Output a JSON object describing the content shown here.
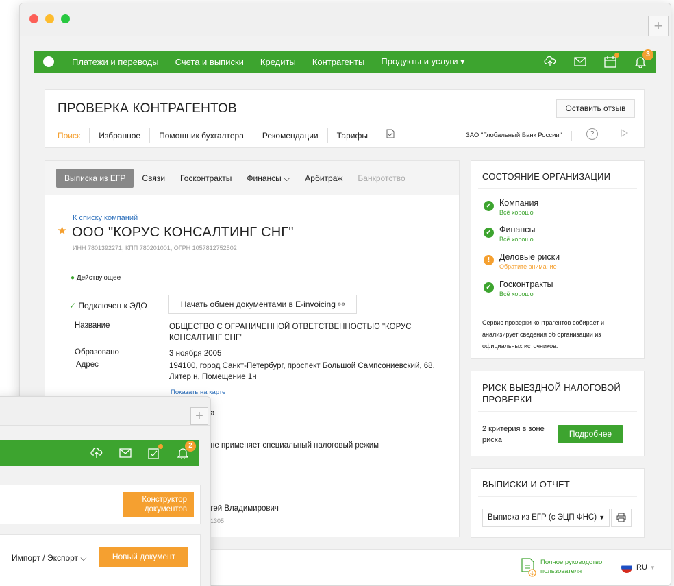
{
  "window": {
    "controls": [
      "close",
      "minimize",
      "maximize"
    ],
    "new_tab": "+"
  },
  "nav": {
    "items": [
      "Платежи и переводы",
      "Счета и выписки",
      "Кредиты",
      "Контрагенты",
      "Продукты и услуги ▾"
    ],
    "notifications_count": "3"
  },
  "header": {
    "title": "ПРОВЕРКА КОНТРАГЕНТОВ",
    "feedback_button": "Оставить отзыв",
    "tabs": [
      "Поиск",
      "Избранное",
      "Помощник бухгалтера",
      "Рекомендации",
      "Тарифы"
    ],
    "company_selector": "ЗАО \"Глобальный Банк России\""
  },
  "main": {
    "tabs": [
      "Выписка из ЕГР",
      "Связи",
      "Госконтракты",
      "Финансы",
      "Арбитраж",
      "Банкротство"
    ],
    "back_link": "К списку компаний",
    "company_name": "ООО \"КОРУС КОНСАЛТИНГ СНГ\"",
    "ids": "ИНН 7801392271, КПП 780201001, ОГРН 1057812752502",
    "status": "Действующее",
    "edo_status": "Подключен к ЭДО",
    "edo_button": "Начать обмен документами в E-invoicing",
    "name_label": "Название",
    "name_value": "ОБЩЕСТВО С ОГРАНИЧЕННОЙ ОТВЕТСТВЕННОСТЬЮ \"КОРУС КОНСАЛТИНГ СНГ\"",
    "founded_label": "Образовано",
    "founded_value": "3 ноября 2005",
    "address_label": "Адрес",
    "address_value": "194100, город Санкт-Петербург, проспект Большой Сампсониевский, 68, Литер н, Помещение 1н",
    "map_link": "Показать на карте",
    "partial_1": "а",
    "partial_tax": "не применяет специальный налоговый режим",
    "partial_director": "ргей Владимирович",
    "partial_inn": "1305"
  },
  "org_state": {
    "title": "СОСТОЯНИЕ ОРГАНИЗАЦИИ",
    "items": [
      {
        "name": "Компания",
        "status": "Всё хорошо"
      },
      {
        "name": "Финансы",
        "status": "Всё хорошо"
      },
      {
        "name": "Деловые риски",
        "status": "Обратите внимание"
      },
      {
        "name": "Госконтракты",
        "status": "Всё хорошо"
      }
    ],
    "note": "Сервис проверки контрагентов собирает и анализирует сведения об организации из официальных источников."
  },
  "tax_risk": {
    "title": "РИСК ВЫЕЗДНОЙ НАЛОГОВОЙ ПРОВЕРКИ",
    "text": "2 критерия в зоне риска",
    "button": "Подробнее"
  },
  "reports": {
    "title": "ВЫПИСКИ И ОТЧЕТ",
    "select": "Выписка из ЕГР (с ЭЦП ФНС)"
  },
  "footer": {
    "guide": "Полное руководство пользователя",
    "lang": "RU"
  },
  "window2": {
    "notifications_count": "2",
    "constructor_button": "Конструктор документов",
    "import_export": "Импорт / Экспорт",
    "new_doc_button": "Новый документ"
  },
  "colors": {
    "green": "#3da42f",
    "orange": "#f5a030",
    "link": "#2a6ebb"
  }
}
